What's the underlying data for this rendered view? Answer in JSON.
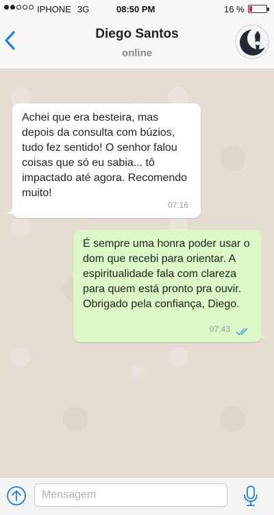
{
  "status_bar": {
    "carrier": "IPHONE",
    "network": "3G",
    "time": "08:50 PM",
    "battery_percent": "16 %",
    "battery_level": 0.16,
    "signal_bars_filled": 2,
    "signal_bars_total": 5
  },
  "header": {
    "contact_name": "Diego Santos",
    "contact_status": "online"
  },
  "messages": [
    {
      "direction": "incoming",
      "text": "Achei que era besteira, mas depois da consulta com búzios, tudo fez sentido! O senhor falou coisas que só eu sabia... tô impactado até agora. Recomendo muito!",
      "time": "07:16"
    },
    {
      "direction": "outgoing",
      "text": "É sempre uma honra poder usar o dom que recebi para orientar. A espiritualidade fala com clareza para quem está pronto pra ouvir. Obrigado pela confiança, Diego.",
      "time": "07:43",
      "read": true
    }
  ],
  "input": {
    "placeholder": "Mensagem",
    "value": ""
  },
  "colors": {
    "accent": "#1c7ed6",
    "incoming_bubble": "#ffffff",
    "outgoing_bubble": "#dcf8c6",
    "chat_background": "#e5ddd3",
    "read_ticks": "#4fa6e0",
    "battery_low": "#e0242a"
  },
  "icons": {
    "back": "chevron-left-icon",
    "avatar": "crescent-moon-logo",
    "send": "arrow-up-circle-icon",
    "mic": "microphone-icon",
    "read": "double-check-icon"
  }
}
